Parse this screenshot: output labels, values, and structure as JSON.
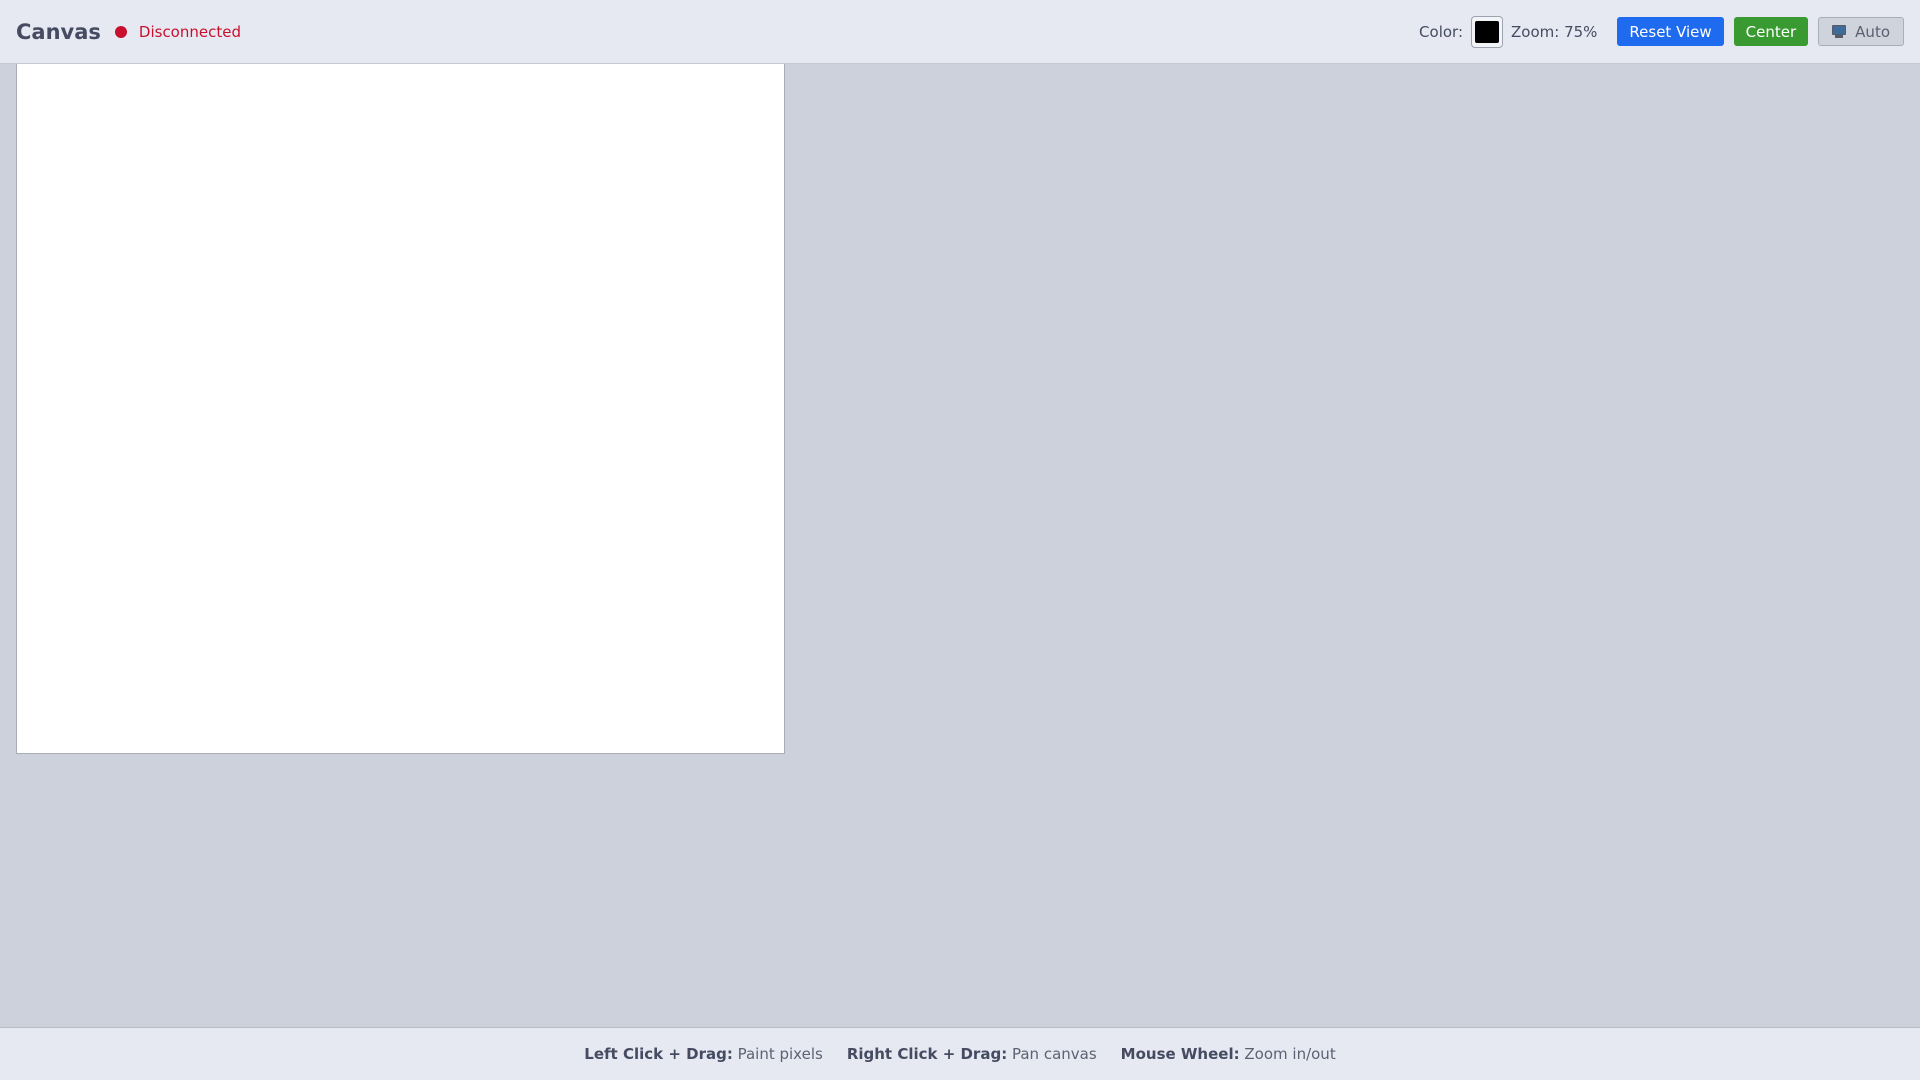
{
  "header": {
    "title": "Canvas",
    "status": {
      "label": "Disconnected",
      "color": "#c8102e"
    },
    "color_label": "Color:",
    "current_color": "#000000",
    "zoom_label": "Zoom: 75%",
    "buttons": {
      "reset_view": {
        "label": "Reset View",
        "color": "#1f6bf0"
      },
      "center": {
        "label": "Center",
        "color": "#3a9a32"
      },
      "auto": {
        "label": "Auto",
        "icon": "monitor-icon"
      }
    }
  },
  "canvas": {
    "background": "#ffffff"
  },
  "footer": {
    "hints": [
      {
        "key": "Left Click + Drag:",
        "desc": "Paint pixels"
      },
      {
        "key": "Right Click + Drag:",
        "desc": "Pan canvas"
      },
      {
        "key": "Mouse Wheel:",
        "desc": "Zoom in/out"
      }
    ]
  }
}
